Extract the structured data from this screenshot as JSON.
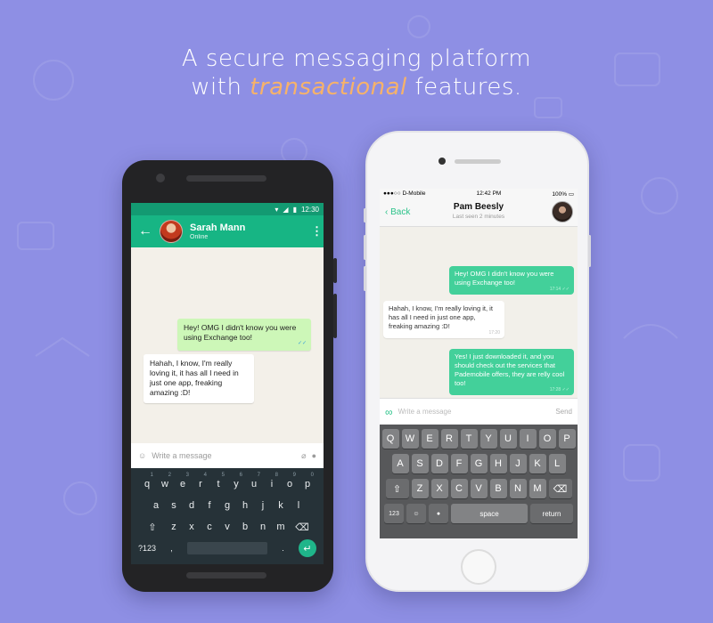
{
  "headline": {
    "line1": "A secure messaging platform",
    "line2_before": "with ",
    "line2_highlight": "transactional",
    "line2_after": " features."
  },
  "colors": {
    "background": "#8e8fe4",
    "accent": "#17b584",
    "highlight": "#f6b26a"
  },
  "android": {
    "status_time": "12:30",
    "contact_name": "Sarah Mann",
    "contact_status": "Online",
    "messages": [
      {
        "from": "me",
        "text": "Hey! OMG I didn't know you were using Exchange too!"
      },
      {
        "from": "them",
        "text": "Hahah, I know, I'm really loving it, it has all I need in just one app, freaking amazing :D!"
      }
    ],
    "input_placeholder": "Write a message",
    "keyboard": {
      "row1": [
        "q",
        "w",
        "e",
        "r",
        "t",
        "y",
        "u",
        "i",
        "o",
        "p"
      ],
      "row1_hints": [
        "1",
        "2",
        "3",
        "4",
        "5",
        "6",
        "7",
        "8",
        "9",
        "0"
      ],
      "row2": [
        "a",
        "s",
        "d",
        "f",
        "g",
        "h",
        "j",
        "k",
        "l"
      ],
      "row3": [
        "z",
        "x",
        "c",
        "v",
        "b",
        "n",
        "m"
      ],
      "symbols_label": "?123",
      "comma": ",",
      "period": "."
    }
  },
  "iphone": {
    "carrier": "D-Mobile",
    "status_time": "12:42 PM",
    "battery": "100%",
    "back_label": "Back",
    "contact_name": "Pam Beesly",
    "contact_status": "Last seen 2 minutes",
    "messages": [
      {
        "from": "me",
        "text": "Hey! OMG I didn't know you were using Exchange too!",
        "time": "17:14"
      },
      {
        "from": "them",
        "text": "Hahah, I know, I'm really loving it, it has all I need in just one app, freaking amazing :D!",
        "time": "17:20"
      },
      {
        "from": "me",
        "text": "Yes! I just downloaded it, and you should check out the services that Pademobile offers, they are relly cool too!",
        "time": "17:28"
      }
    ],
    "input_placeholder": "Write a message",
    "send_label": "Send",
    "keyboard": {
      "row1": [
        "Q",
        "W",
        "E",
        "R",
        "T",
        "Y",
        "U",
        "I",
        "O",
        "P"
      ],
      "row2": [
        "A",
        "S",
        "D",
        "F",
        "G",
        "H",
        "J",
        "K",
        "L"
      ],
      "row3": [
        "Z",
        "X",
        "C",
        "V",
        "B",
        "N",
        "M"
      ],
      "numbers_label": "123",
      "space_label": "space",
      "return_label": "return"
    }
  }
}
